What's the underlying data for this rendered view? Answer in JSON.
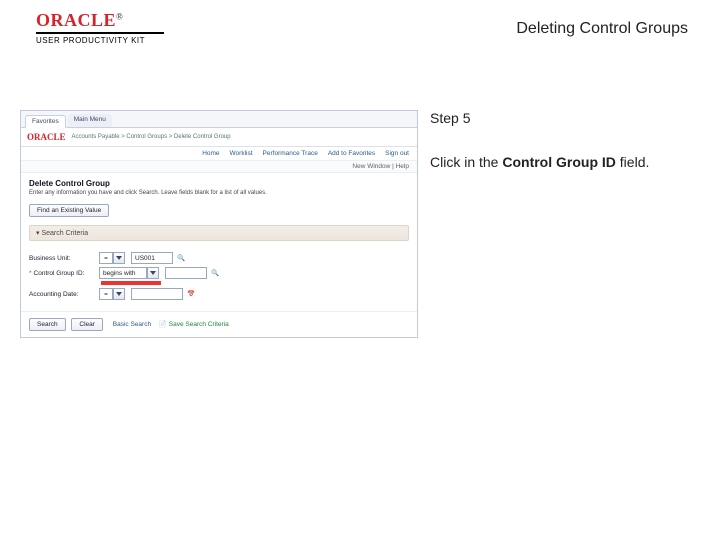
{
  "brand": {
    "name": "ORACLE",
    "tm": "®",
    "subline": "USER PRODUCTIVITY KIT"
  },
  "page_title": "Deleting Control Groups",
  "step": {
    "label": "Step 5"
  },
  "instruction": {
    "pre": "Click in the ",
    "emph": "Control Group ID",
    "post": " field."
  },
  "app": {
    "tabs": {
      "t1": "Favorites",
      "t2": "Main Menu"
    },
    "breadcrumb": "Accounts Payable  >  Control Groups  >  Delete Control Group",
    "links": {
      "l1": "Home",
      "l2": "Worklist",
      "l3": "Performance Trace",
      "l4": "Add to Favorites",
      "l5": "Sign out"
    },
    "meta": "New Window | Help",
    "page_heading": "Delete Control Group",
    "description": "Enter any information you have and click Search. Leave fields blank for a list of all values.",
    "buttons": {
      "find": "Find an Existing Value"
    },
    "band": "▾  Search Criteria",
    "fields": {
      "bu_label": "Business Unit:",
      "bu_op": "=",
      "bu_value": "US001",
      "cg_label": "Control Group ID:",
      "cg_op": "begins with",
      "ad_label": "Accounting Date:",
      "ad_op": "="
    },
    "footer": {
      "search": "Search",
      "clear": "Clear",
      "basic": "Basic Search",
      "save": "Save Search Criteria"
    }
  }
}
